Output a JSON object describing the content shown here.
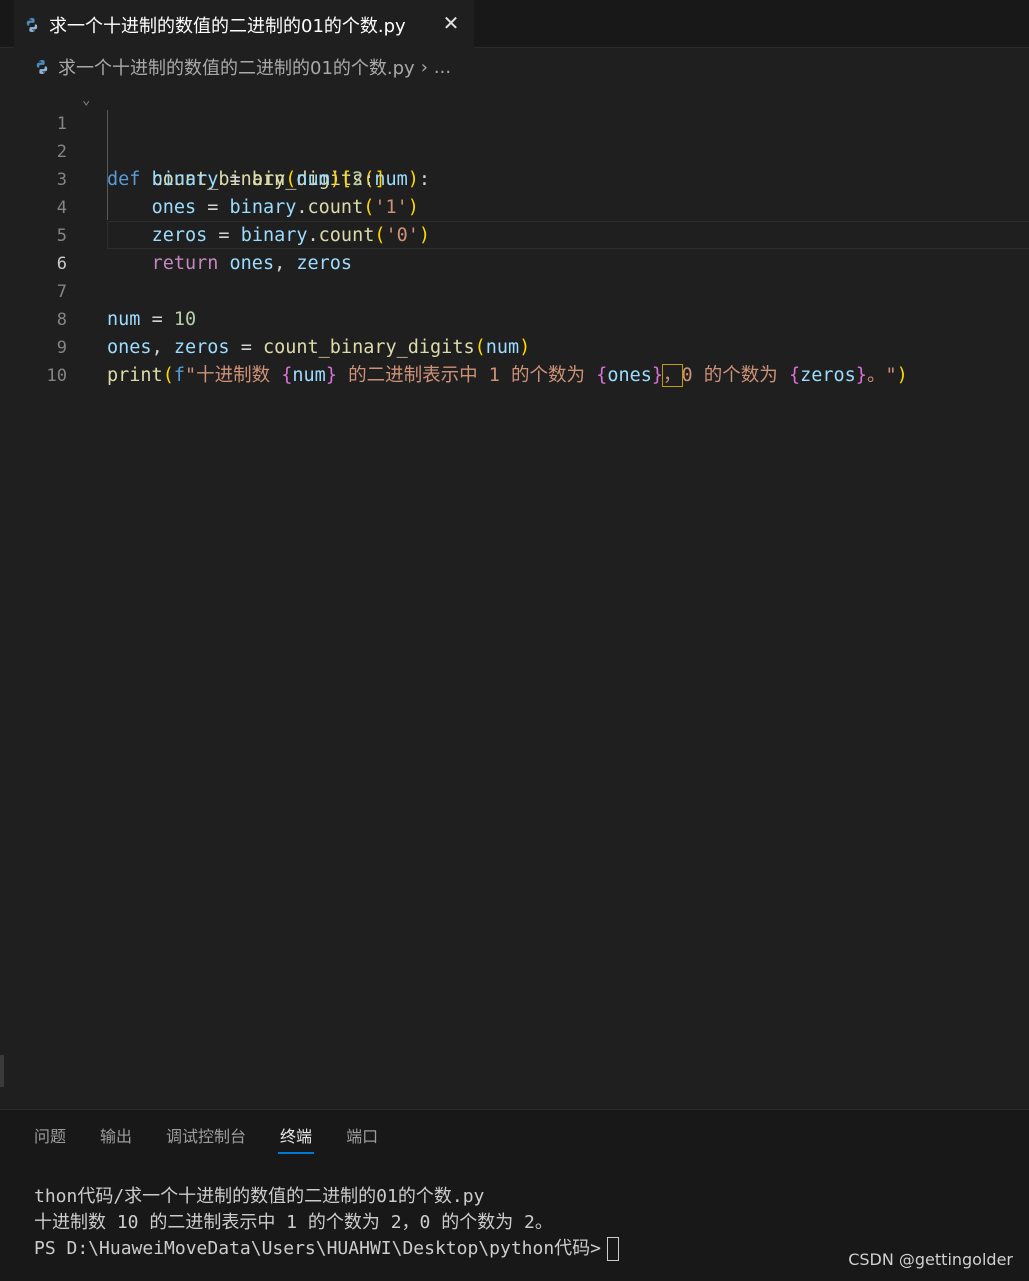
{
  "tab": {
    "title": "求一个十进制的数值的二进制的01的个数.py",
    "close_glyph": "✕",
    "icon": "python-icon"
  },
  "breadcrumb": {
    "file": "求一个十进制的数值的二进制的01的个数.py",
    "separator": "›",
    "more": "..."
  },
  "editor": {
    "line_numbers": [
      "1",
      "2",
      "3",
      "4",
      "5",
      "6",
      "7",
      "8",
      "9",
      "10"
    ],
    "active_line": 6,
    "lines": [
      "def count_binary_digits(num):",
      "    binary = bin(num)[2:]",
      "    ones = binary.count('1')",
      "    zeros = binary.count('0')",
      "    return ones, zeros",
      "",
      "num = 10",
      "ones, zeros = count_binary_digits(num)",
      "print(f\"十进制数 {num} 的二进制表示中 1 的个数为 {ones}，0 的个数为 {zeros}。\")",
      ""
    ]
  },
  "panel": {
    "tabs": [
      {
        "label": "问题",
        "active": false
      },
      {
        "label": "输出",
        "active": false
      },
      {
        "label": "调试控制台",
        "active": false
      },
      {
        "label": "终端",
        "active": true
      },
      {
        "label": "端口",
        "active": false
      }
    ],
    "terminal": {
      "line1": "thon代码/求一个十进制的数值的二进制的01的个数.py",
      "line2": "十进制数 10 的二进制表示中 1 的个数为 2，0 的个数为 2。",
      "prompt": "PS D:\\HuaweiMoveData\\Users\\HUAHWI\\Desktop\\python代码>"
    }
  },
  "watermark": "CSDN @gettingolder",
  "colors": {
    "background": "#1f1f1f",
    "keyword": "#569cd6",
    "function": "#dcdcaa",
    "variable": "#9cdcfe",
    "string": "#ce9178",
    "number": "#b5cea8",
    "accent": "#0078d4"
  }
}
